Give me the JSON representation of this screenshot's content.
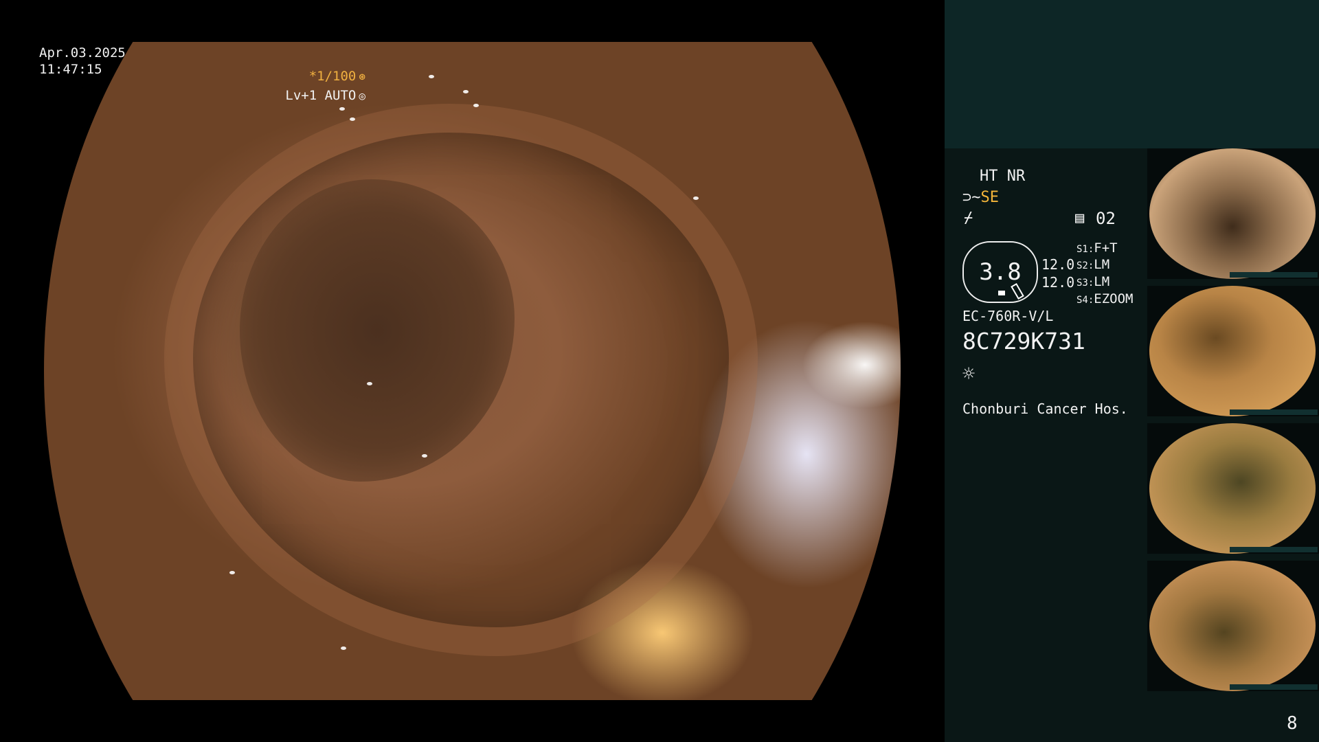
{
  "overlay": {
    "date": "Apr.03.2025",
    "time": "11:47:15",
    "shutter": "*1/100",
    "shutter_icon": "⊛",
    "level": "Lv+1 AUTO",
    "level_icon": "◎"
  },
  "panel": {
    "ht_nr": "HT NR",
    "se_prefix": "⊃~",
    "se_label": "SE",
    "curve_icon": "⌿",
    "record_icon": "▤",
    "record_count": "02",
    "gauge_value": "3.8",
    "gauge_side_1": "12.0",
    "gauge_side_2": "12.0",
    "settings": [
      {
        "key": "S1:",
        "value": "F+T"
      },
      {
        "key": "S2:",
        "value": "LM"
      },
      {
        "key": "S3:",
        "value": "LM"
      },
      {
        "key": "S4:",
        "value": "EZOOM"
      }
    ],
    "scope_model": "EC-760R-V/L",
    "scope_serial": "8C729K731",
    "light_icon": "☼",
    "hospital": "Chonburi Cancer Hos.",
    "page_number": "8"
  },
  "colors": {
    "accent": "#f5b63a",
    "panel_bg": "#0a1716",
    "panel_header_bg": "#0d2626",
    "text": "#f2f2f2"
  }
}
